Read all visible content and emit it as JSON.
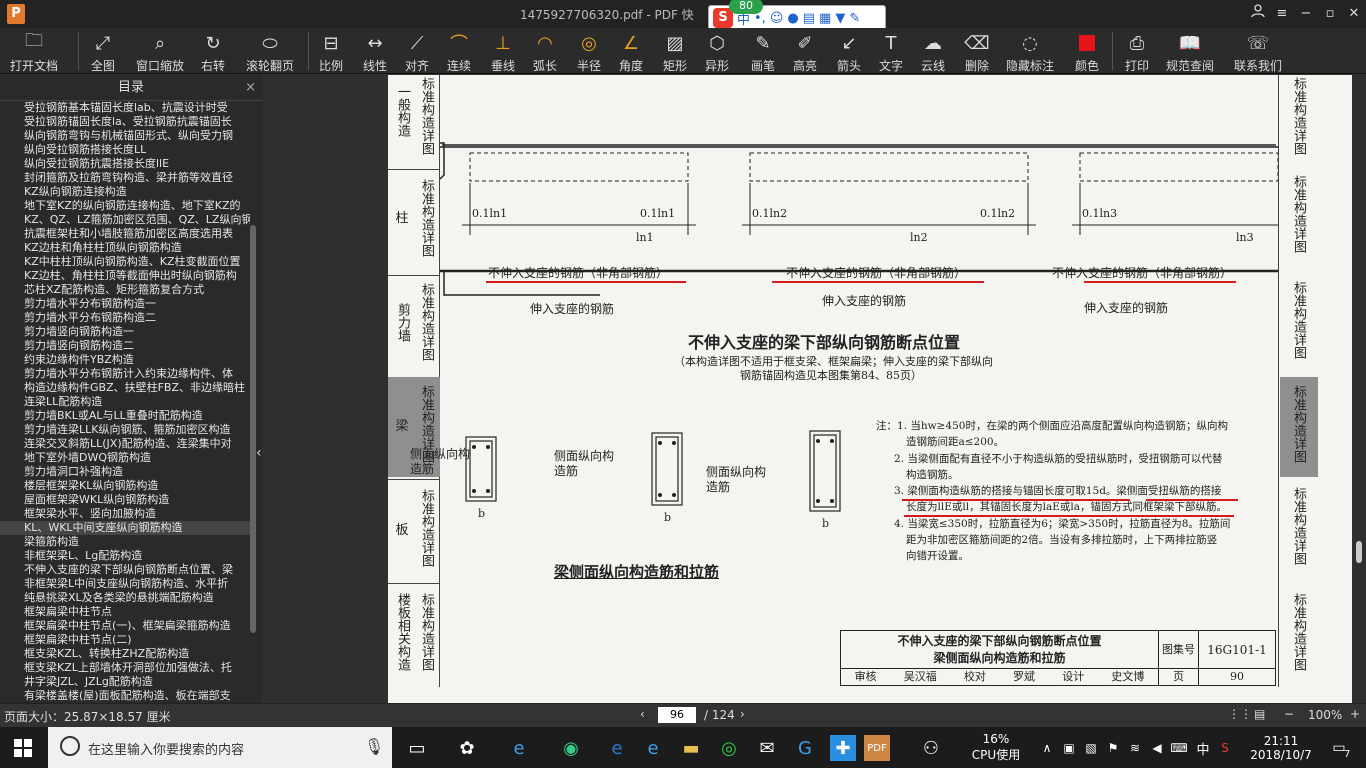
{
  "titlebar": {
    "logo": "P",
    "title": "1475927706320.pdf - PDF 快",
    "user_icon": "user-icon",
    "menu_icon": "menu-icon"
  },
  "ime": {
    "badge": "80",
    "mode": "中",
    "punct": "•,"
  },
  "toolbar": [
    {
      "label": "打开文档",
      "icon": "folder-icon"
    },
    {
      "label": "全图",
      "icon": "fit-page-icon"
    },
    {
      "label": "窗口缩放",
      "icon": "zoom-icon"
    },
    {
      "label": "右转",
      "icon": "rotate-icon"
    },
    {
      "label": "滚轮翻页",
      "icon": "mouse-icon"
    },
    {
      "label": "比例",
      "icon": "scale-icon"
    },
    {
      "label": "线性",
      "icon": "linear-icon"
    },
    {
      "label": "对齐",
      "icon": "align-icon"
    },
    {
      "label": "连续",
      "icon": "continuous-icon"
    },
    {
      "label": "垂线",
      "icon": "perpendicular-icon"
    },
    {
      "label": "弧长",
      "icon": "arc-icon"
    },
    {
      "label": "半径",
      "icon": "radius-icon"
    },
    {
      "label": "角度",
      "icon": "angle-icon"
    },
    {
      "label": "矩形",
      "icon": "rectangle-icon"
    },
    {
      "label": "异形",
      "icon": "polygon-icon"
    },
    {
      "label": "画笔",
      "icon": "pen-icon"
    },
    {
      "label": "高亮",
      "icon": "highlight-icon"
    },
    {
      "label": "箭头",
      "icon": "arrow-icon"
    },
    {
      "label": "文字",
      "icon": "text-icon"
    },
    {
      "label": "云线",
      "icon": "cloud-icon"
    },
    {
      "label": "删除",
      "icon": "eraser-icon"
    },
    {
      "label": "隐藏标注",
      "icon": "hide-icon"
    },
    {
      "label": "颜色",
      "icon": "color-icon",
      "color": "#e8141c"
    },
    {
      "label": "打印",
      "icon": "printer-icon"
    },
    {
      "label": "规范查阅",
      "icon": "book-icon"
    },
    {
      "label": "联系我们",
      "icon": "contact-icon"
    }
  ],
  "sidebar": {
    "title": "目录",
    "items": [
      "受拉钢筋基本锚固长度lab、抗震设计时受",
      "受拉钢筋锚固长度la、受拉钢筋抗震锚固长",
      "纵向钢筋弯钩与机械锚固形式、纵向受力钢",
      "纵向受拉钢筋搭接长度LL",
      "纵向受拉钢筋抗震搭接长度llE",
      "封闭箍筋及拉筋弯钩构造、梁并筋等效直径",
      "KZ纵向钢筋连接构造",
      "地下室KZ的纵向钢筋连接构造、地下室KZ的",
      "KZ、QZ、LZ箍筋加密区范围、QZ、LZ纵向钢",
      "抗震框架柱和小墙肢箍筋加密区高度选用表",
      "KZ边柱和角柱柱顶纵向钢筋构造",
      "KZ中柱柱顶纵向钢筋构造、KZ柱变截面位置",
      "KZ边柱、角柱柱顶等截面伸出时纵向钢筋构",
      "芯柱XZ配筋构造、矩形箍筋复合方式",
      "剪力墙水平分布钢筋构造一",
      "剪力墙水平分布钢筋构造二",
      "剪力墙竖向钢筋构造一",
      "剪力墙竖向钢筋构造二",
      "约束边缘构件YBZ构造",
      "剪力墙水平分布钢筋计入约束边缘构件、体",
      "构造边缘构件GBZ、扶壁柱FBZ、非边缘暗柱",
      "连梁LL配筋构造",
      "剪力墙BKL或AL与LL重叠时配筋构造",
      "剪力墙连梁LLK纵向钢筋、箍筋加密区构造",
      "连梁交叉斜筋LL(JX)配筋构造、连梁集中对",
      "地下室外墙DWQ钢筋构造",
      "剪力墙洞口补强构造",
      "楼层框架梁KL纵向钢筋构造",
      "屋面框架梁WKL纵向钢筋构造",
      "框架梁水平、竖向加腋构造",
      "KL、WKL中间支座纵向钢筋构造",
      "梁箍筋构造",
      "非框架梁L、Lg配筋构造",
      "不伸入支座的梁下部纵向钢筋断点位置、梁",
      "非框架梁L中间支座纵向钢筋构造、水平折",
      "纯悬挑梁XL及各类梁的悬挑端配筋构造",
      "框架扁梁中柱节点",
      "框架扁梁中柱节点(一)、框架扁梁箍筋构造",
      "框架扁梁中柱节点(二)",
      "框支梁KZL、转换柱ZHZ配筋构造",
      "框支梁KZL上部墙体开洞部位加强做法、托",
      "井字梁JZL、JZLg配筋构造",
      "有梁楼盖楼(屋)面板配筋构造、板在端部支"
    ],
    "selected_index": 30
  },
  "page": {
    "left_tabs": [
      {
        "text": "一般构造",
        "side": "标准构造详图"
      },
      {
        "text": "柱",
        "side": "标准构造详图"
      },
      {
        "text": "剪力墙",
        "side": "标准构造详图"
      },
      {
        "text": "梁",
        "side": "标准构造详图"
      },
      {
        "text": "板",
        "side": "标准构造详图"
      },
      {
        "text": "楼板相关构造",
        "side": "标准构造详图"
      }
    ],
    "right_tabs": [
      "标准构造详图",
      "标准构造详图",
      "标准构造详图",
      "标准构造详图",
      "标准构造详图",
      "标准构造详图"
    ],
    "labels_top": [
      "0.1ln1",
      "0.1ln1",
      "0.1ln2",
      "0.1ln2",
      "0.1ln3"
    ],
    "span_labels": [
      "ln1",
      "ln2",
      "ln3"
    ],
    "not_into_support": "不伸入支座的钢筋（非角部钢筋）",
    "into_support": "伸入支座的钢筋",
    "title1": "不伸入支座的梁下部纵向钢筋断点位置",
    "subtitle1": "（本构造详图不适用于框支梁、框架扁梁；伸入支座的梁下部纵向",
    "subtitle1b": "钢筋锚固构造见本图集第84、85页）",
    "side_label": "侧面纵向构造筋",
    "dim_b": "b",
    "title2": "梁侧面纵向构造筋和拉筋",
    "notes": [
      "注：1. 当hw≥450时，在梁的两个侧面应沿高度配置纵向构造钢筋；纵向构",
      "造钢筋间距a≤200。",
      "2. 当梁侧面配有直径不小于构造纵筋的受扭纵筋时，受扭钢筋可以代替",
      "构造钢筋。",
      "3. 梁侧面构造纵筋的搭接与锚固长度可取15d。梁侧面受扭纵筋的搭接",
      "长度为llE或ll，其锚固长度为laE或la，锚固方式同框架梁下部纵筋。",
      "4. 当梁宽≤350时，拉筋直径为6；梁宽>350时，拉筋直径为8。拉筋间",
      "距为非加密区箍筋间距的2倍。当设有多排拉筋时，上下两排拉筋竖",
      "向错开设置。"
    ],
    "titleblock": {
      "line1": "不伸入支座的梁下部纵向钢筋断点位置",
      "line2": "梁侧面纵向构造筋和拉筋",
      "atlas_label": "图集号",
      "atlas_no": "16G101-1",
      "row": [
        "审核",
        "吴汉福",
        "校对",
        "罗斌",
        "设计",
        "史文博"
      ],
      "page_label": "页",
      "page_no": "90"
    }
  },
  "statusbar": {
    "page_size": "页面大小：25.87×18.57 厘米",
    "current_page": "96",
    "total": "/ 124",
    "zoom": "100%"
  },
  "taskbar": {
    "search_placeholder": "在这里输入你要搜索的内容",
    "cpu_percent": "16%",
    "cpu_label": "CPU使用",
    "ime_lang": "中",
    "time": "21:11",
    "date": "2018/10/7",
    "notif_count": "7"
  }
}
